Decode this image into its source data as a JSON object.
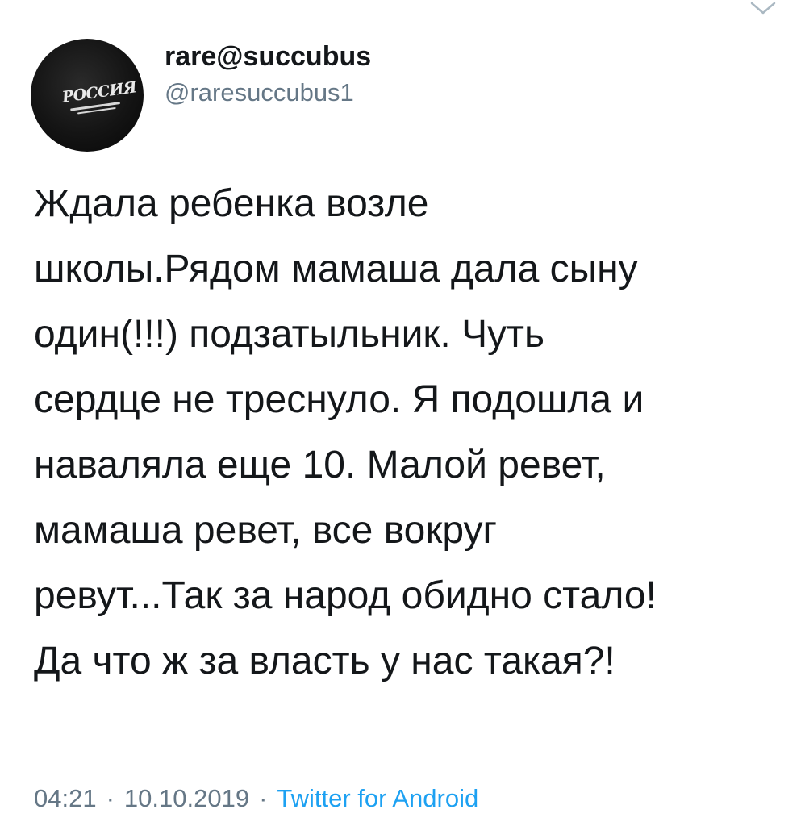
{
  "tweet": {
    "author": {
      "display_name": "rare@succubus",
      "handle": "@raresuccubus1",
      "avatar_text": "РОССИЯ"
    },
    "text_lines": [
      "Ждала ребенка возле",
      "школы.Рядом мамаша дала сыну",
      "один(!!!) подзатыльник. Чуть",
      "сердце не треснуло. Я подошла и",
      "наваляла еще 10. Малой ревет,",
      "мамаша ревет, все вокруг",
      "ревут...Так за народ обидно стало!",
      "Да что ж за власть у нас такая?!"
    ],
    "time": "04:21",
    "date": "10.10.2019",
    "separator": "·",
    "source": "Twitter for Android",
    "menu_icon": "chevron-down-icon"
  },
  "colors": {
    "text": "#14171a",
    "secondary": "#657786",
    "link": "#1da1f2",
    "chevron": "#aab8c2"
  }
}
